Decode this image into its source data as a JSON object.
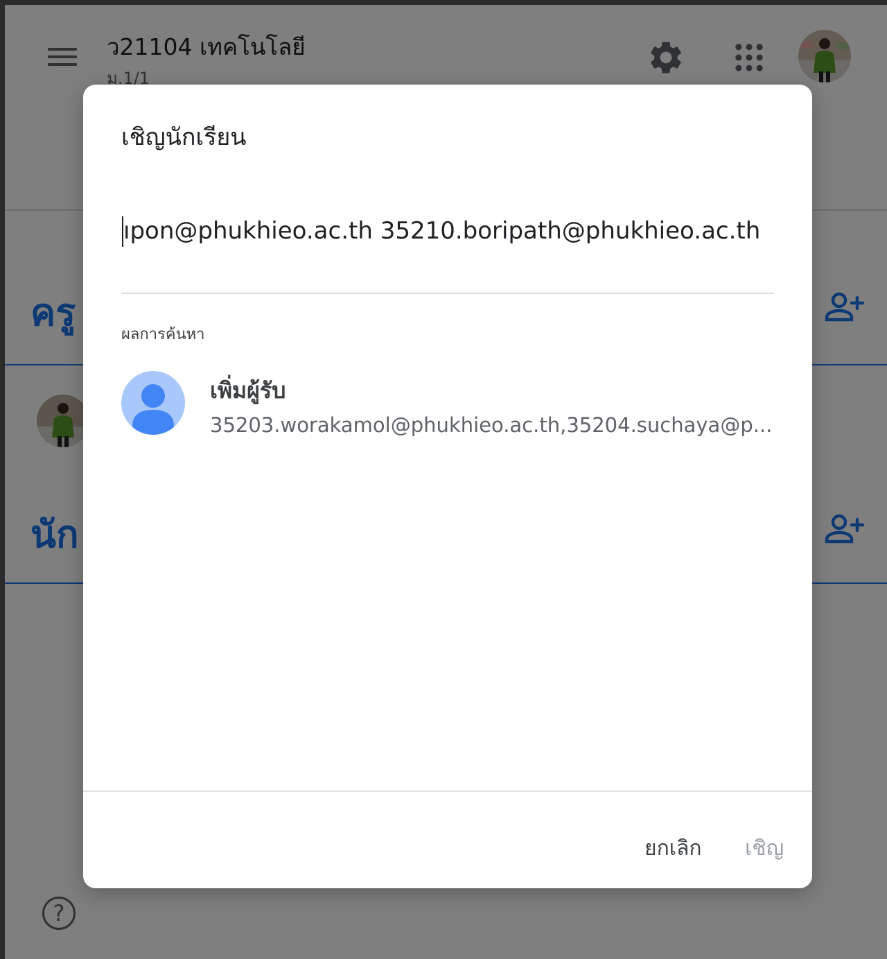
{
  "header": {
    "class_title": "ว21104 เทคโนโลยี",
    "class_subtitle": "ม.1/1"
  },
  "people": {
    "teachers_heading": "ครู",
    "students_heading": "นัก"
  },
  "dialog": {
    "title": "เชิญนักเรียน",
    "input_value": "ıpon@phukhieo.ac.th 35210.boripath@phukhieo.ac.th",
    "results_label": "ผลการค้นหา",
    "result": {
      "name": "เพิ่มผู้รับ",
      "emails": "35203.worakamol@phukhieo.ac.th,35204.suchaya@p..."
    },
    "cancel_label": "ยกเลิก",
    "invite_label": "เชิญ"
  },
  "help": {
    "symbol": "?"
  },
  "colors": {
    "accent": "#1a73e8",
    "avatar_placeholder_bg": "#a8c7fa",
    "avatar_placeholder_fg": "#4285f4",
    "disabled_text": "#9aa0a6"
  },
  "icons": [
    "menu-icon",
    "gear-icon",
    "apps-grid-icon",
    "add-person-icon",
    "help-icon",
    "person-icon"
  ]
}
